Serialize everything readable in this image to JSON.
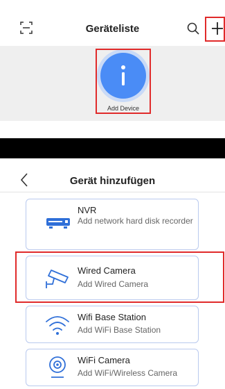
{
  "top_screen": {
    "title": "Geräteliste",
    "icons": [
      "scan-icon",
      "search-icon",
      "add-icon"
    ],
    "add_device_label": "Add Device",
    "accent_color": "#4a8cf6",
    "highlight_color": "#e02a2a"
  },
  "add_screen": {
    "title": "Gerät hinzufügen",
    "back_icon": "chevron-left-icon",
    "devices": [
      {
        "title": "NVR",
        "subtitle": "Add network hard disk recorder",
        "icon": "nvr-icon"
      },
      {
        "title": "Wired Camera",
        "subtitle": "Add Wired Camera",
        "icon": "camera-icon"
      },
      {
        "title": "Wifi Base Station",
        "subtitle": "Add WiFi Base Station",
        "icon": "wifi-icon"
      },
      {
        "title": "WiFi Camera",
        "subtitle": "Add WiFi/Wireless Camera",
        "icon": "wifi-camera-icon"
      }
    ]
  }
}
